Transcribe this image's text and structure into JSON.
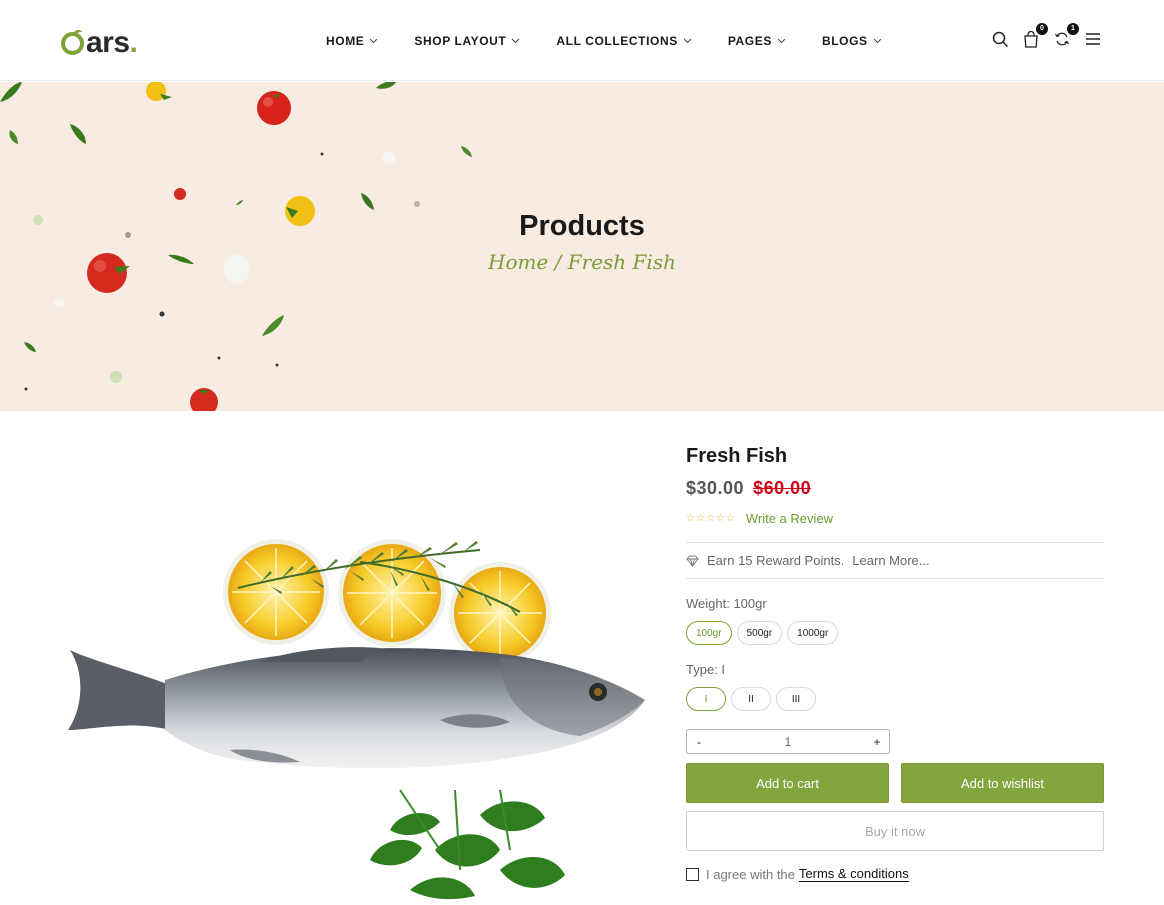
{
  "header": {
    "logo_text": "ars",
    "logo_dot": ".",
    "nav": [
      {
        "label": "HOME"
      },
      {
        "label": "SHOP LAYOUT"
      },
      {
        "label": "ALL COLLECTIONS"
      },
      {
        "label": "PAGES"
      },
      {
        "label": "BLOGS"
      }
    ],
    "icons": {
      "search": "search-icon",
      "cart": "cart-icon",
      "compare": "compare-icon",
      "menu": "menu-icon"
    },
    "cart_count": "0",
    "compare_count": "1"
  },
  "banner": {
    "title": "Products",
    "breadcrumb_home": "Home",
    "breadcrumb_sep": " / ",
    "breadcrumb_current": "Fresh Fish"
  },
  "product": {
    "title": "Fresh Fish",
    "price": "$30.00",
    "compare_price": "$60.00",
    "rating": 0,
    "write_review": "Write a Review",
    "rewards_text": "Earn 15 Reward Points.",
    "learn_more": "Learn More...",
    "weight_label": "Weight: 100gr",
    "weights": [
      "100gr",
      "500gr",
      "1000gr"
    ],
    "type_label": "Type: I",
    "types": [
      "I",
      "II",
      "III"
    ],
    "qty_minus": "-",
    "qty_value": "1",
    "qty_plus": "+",
    "add_to_cart": "Add to cart",
    "add_to_wishlist": "Add to wishlist",
    "buy_now": "Buy it now",
    "agree_text": "I agree with the",
    "terms_link": "Terms & conditions"
  },
  "colors": {
    "accent": "#84a43e",
    "sale": "#d0021b",
    "banner_bg": "#f8ece2"
  }
}
